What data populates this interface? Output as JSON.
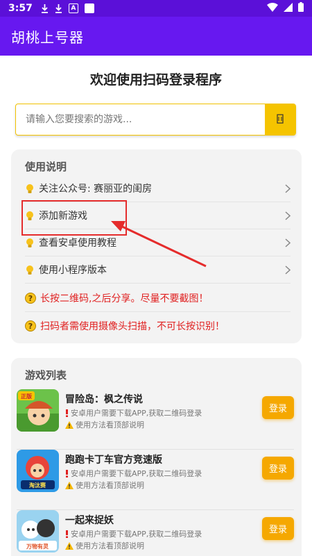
{
  "status_bar": {
    "time": "3:57",
    "notif_icon_letter": "A"
  },
  "app_bar": {
    "title": "胡桃上号器"
  },
  "welcome": "欢迎使用扫码登录程序",
  "search": {
    "placeholder": "请输入您要搜索的游戏..."
  },
  "instructions": {
    "title": "使用说明",
    "items": [
      {
        "label": "关注公众号: 赛丽亚的闺房"
      },
      {
        "label": "添加新游戏"
      },
      {
        "label": "查看安卓使用教程"
      },
      {
        "label": "使用小程序版本"
      }
    ],
    "warnings": [
      "长按二维码,之后分享。尽量不要截图！",
      "扫码者需使用摄像头扫描，不可长按识别！"
    ]
  },
  "games": {
    "title": "游戏列表",
    "login_label": "登录",
    "items": [
      {
        "name": "冒险岛：枫之传说",
        "note1": "安卓用户需要下载APP,获取二维码登录",
        "note2": "使用方法看顶部说明",
        "thumb_text": "正版"
      },
      {
        "name": "跑跑卡丁车官方竞速版",
        "note1": "安卓用户需要下载APP,获取二维码登录",
        "note2": "使用方法看顶部说明",
        "thumb_text": "淘汰赛"
      },
      {
        "name": "一起来捉妖",
        "note1": "安卓用户需要下载APP,获取二维码登录",
        "note2": "使用方法看顶部说明",
        "thumb_text": "万物有灵"
      }
    ]
  },
  "colors": {
    "primary": "#6718f0",
    "status": "#5b10d8",
    "accent": "#f5c400",
    "button": "#f5a800",
    "warn": "#e02020"
  }
}
